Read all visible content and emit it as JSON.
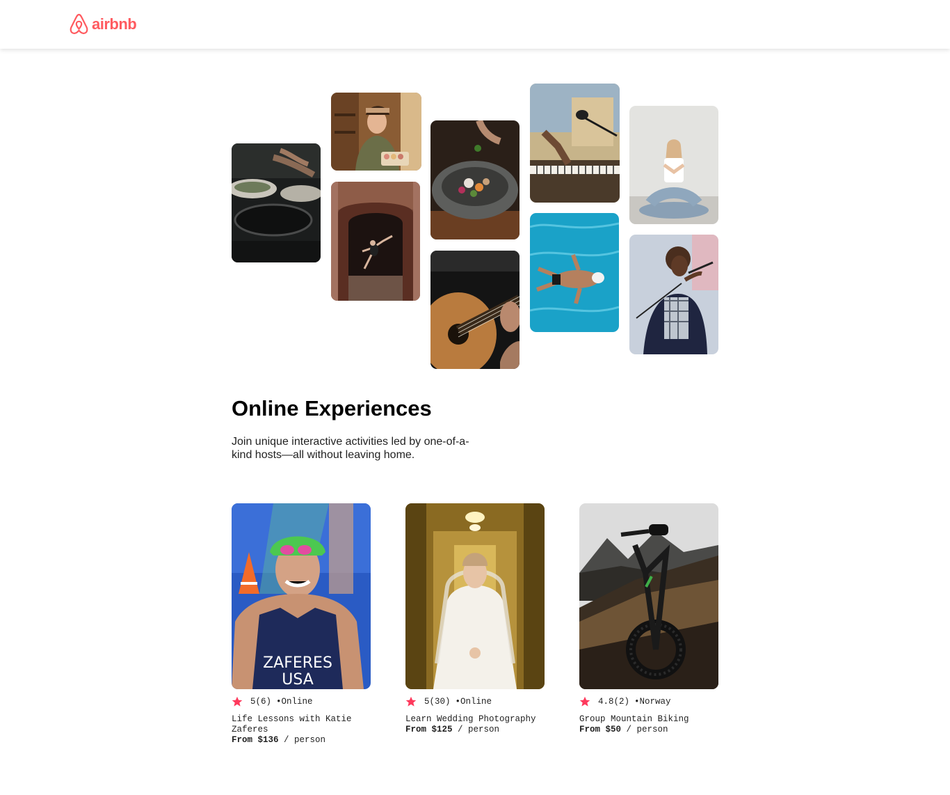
{
  "brand": {
    "name": "airbnb",
    "color": "#FF5A5F",
    "icon": "airbnb-logo-icon"
  },
  "photos": [
    {
      "name": "cooking-photo",
      "subject": "cooking"
    },
    {
      "name": "baker-woman-photo",
      "subject": "baker woman"
    },
    {
      "name": "dancer-doorway-photo",
      "subject": "dancer in doorway"
    },
    {
      "name": "dish-bowl-photo",
      "subject": "dish in bowl"
    },
    {
      "name": "guitar-photo",
      "subject": "guitar"
    },
    {
      "name": "piano-microphone-photo",
      "subject": "piano and microphone"
    },
    {
      "name": "swimmer-photo",
      "subject": "swimmer"
    },
    {
      "name": "yoga-photo",
      "subject": "yoga"
    },
    {
      "name": "singer-photo",
      "subject": "singer"
    }
  ],
  "hero": {
    "title": "Online Experiences",
    "subtitle": "Join unique interactive activities led by one-of-a-kind hosts—all without leaving home."
  },
  "cards": [
    {
      "rating": "5",
      "reviews": "(6)",
      "location": "•Online",
      "title": "Life Lessons with Katie Zaferes",
      "price_label": "From $136",
      "price_unit": " / person",
      "jersey_text": [
        "ZAFERES",
        "USA"
      ]
    },
    {
      "rating": "5",
      "reviews": "(30)",
      "location": "•Online",
      "title": "Learn Wedding Photography",
      "price_label": "From $125",
      "price_unit": " / person"
    },
    {
      "rating": "4.8",
      "reviews": "(2)",
      "location": "•Norway",
      "title": "Group Mountain Biking",
      "price_label": "From $50",
      "price_unit": " / person"
    }
  ],
  "colors": {
    "star": "#FE395C",
    "accent": "#FF5A5F"
  }
}
